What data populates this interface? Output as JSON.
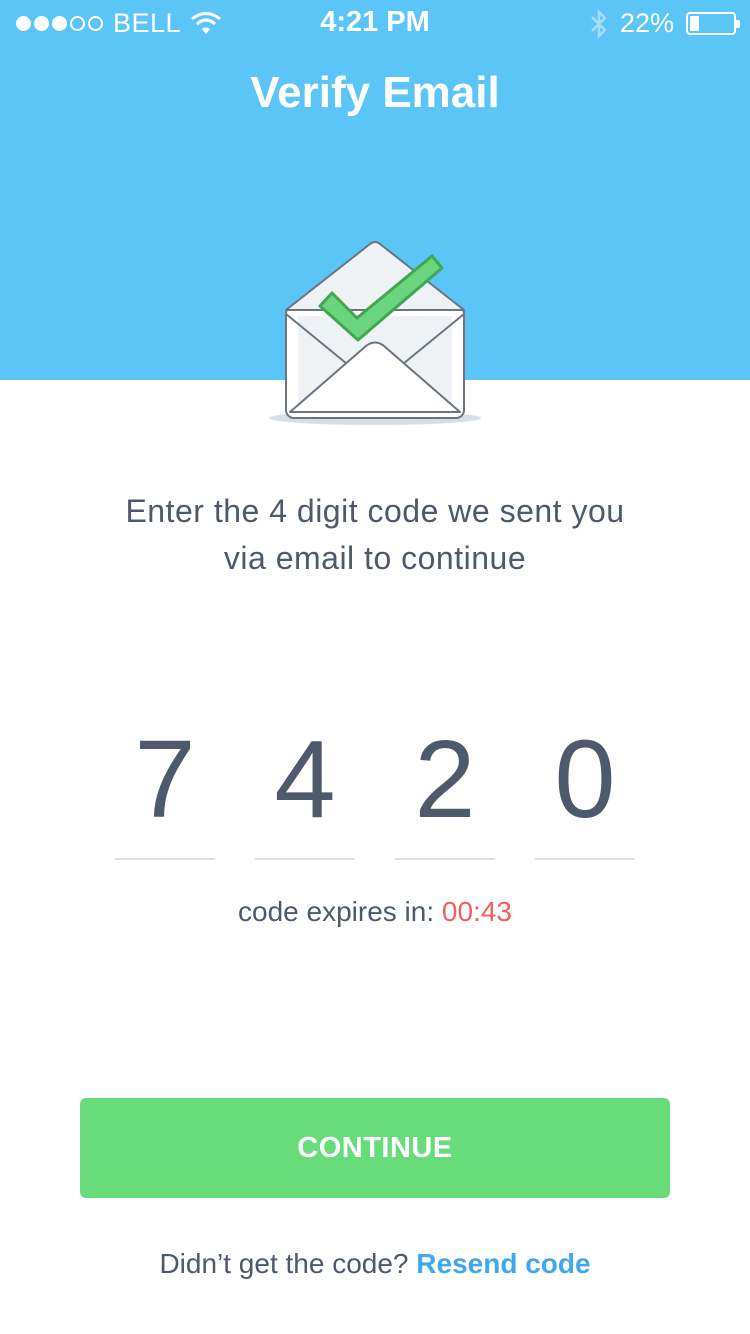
{
  "status_bar": {
    "carrier": "BELL",
    "time": "4:21 PM",
    "battery": "22%",
    "battery_level": 0.22,
    "icons": [
      "signal-icon",
      "wifi-icon",
      "bluetooth-icon",
      "battery-icon"
    ]
  },
  "header": {
    "title": "Verify Email",
    "illustration": "envelope-checkmark-icon"
  },
  "instructions": {
    "line1": "Enter the 4 digit code we sent you",
    "line2": "via email to continue"
  },
  "code": {
    "digits": [
      "7",
      "4",
      "2",
      "0"
    ]
  },
  "expires": {
    "label": "code expires in: ",
    "timer": "00:43"
  },
  "continue_label": "CONTINUE",
  "resend": {
    "prompt": "Didn’t get the code? ",
    "link": "Resend code"
  },
  "colors": {
    "header_bg": "#5bc5f8",
    "button_bg": "#68db7a",
    "timer": "#f25f5c",
    "link": "#3fa8f0",
    "text": "#4e5a6b"
  }
}
